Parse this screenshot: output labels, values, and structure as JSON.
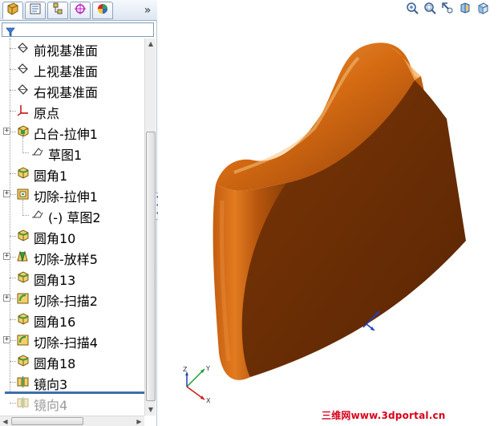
{
  "panel_tabs": [
    {
      "name": "feature-manager",
      "icon": "feature-tree-icon",
      "active": true
    },
    {
      "name": "property-manager",
      "icon": "property-manager-icon",
      "active": false
    },
    {
      "name": "configuration-manager",
      "icon": "configuration-manager-icon",
      "active": false
    },
    {
      "name": "dimxpert-manager",
      "icon": "dimxpert-icon",
      "active": false
    },
    {
      "name": "display-manager",
      "icon": "display-manager-icon",
      "active": false
    }
  ],
  "tab_overflow": "»",
  "filter": {
    "icon": "filter-icon",
    "value": ""
  },
  "tree": {
    "items": [
      {
        "label": "前视基准面",
        "icon": "plane-icon",
        "expandable": false
      },
      {
        "label": "上视基准面",
        "icon": "plane-icon",
        "expandable": false
      },
      {
        "label": "右视基准面",
        "icon": "plane-icon",
        "expandable": false
      },
      {
        "label": "原点",
        "icon": "origin-icon",
        "expandable": false
      },
      {
        "label": "凸台-拉伸1",
        "icon": "boss-extrude-icon",
        "expandable": true
      },
      {
        "label": "草图1",
        "icon": "sketch-icon",
        "expandable": false,
        "child": true
      },
      {
        "label": "圆角1",
        "icon": "fillet-icon",
        "expandable": false
      },
      {
        "label": "切除-拉伸1",
        "icon": "cut-extrude-icon",
        "expandable": true
      },
      {
        "label": "(-) 草图2",
        "icon": "sketch-icon",
        "expandable": false,
        "child": true
      },
      {
        "label": "圆角10",
        "icon": "fillet-icon",
        "expandable": false
      },
      {
        "label": "切除-放样5",
        "icon": "cut-loft-icon",
        "expandable": true
      },
      {
        "label": "圆角13",
        "icon": "fillet-icon",
        "expandable": false
      },
      {
        "label": "切除-扫描2",
        "icon": "cut-sweep-icon",
        "expandable": true
      },
      {
        "label": "圆角16",
        "icon": "fillet-icon",
        "expandable": false
      },
      {
        "label": "切除-扫描4",
        "icon": "cut-sweep-icon",
        "expandable": true
      },
      {
        "label": "圆角18",
        "icon": "fillet-icon",
        "expandable": false
      },
      {
        "label": "镜向3",
        "icon": "mirror-icon",
        "expandable": false
      },
      {
        "label": "镜向4",
        "icon": "mirror-icon",
        "expandable": false,
        "disabled": true
      }
    ]
  },
  "view_toolbar": [
    {
      "name": "zoom-to-fit",
      "icon": "zoom-to-fit-icon"
    },
    {
      "name": "zoom-to-area",
      "icon": "zoom-to-area-icon"
    },
    {
      "name": "previous-view",
      "icon": "previous-view-icon"
    },
    {
      "name": "section-view",
      "icon": "section-view-icon"
    },
    {
      "name": "view-orientation",
      "icon": "view-orientation-icon"
    }
  ],
  "triad_axes": {
    "x": "X",
    "y": "Y",
    "z": "Z"
  },
  "watermark": "三维网www.3dportal.cn",
  "colors": {
    "model_light": "#e07a1e",
    "model_dark": "#6b2f06",
    "model_mid": "#a84c0c",
    "rollback_bar": "#3d6ea8",
    "watermark": "#d9001b"
  }
}
